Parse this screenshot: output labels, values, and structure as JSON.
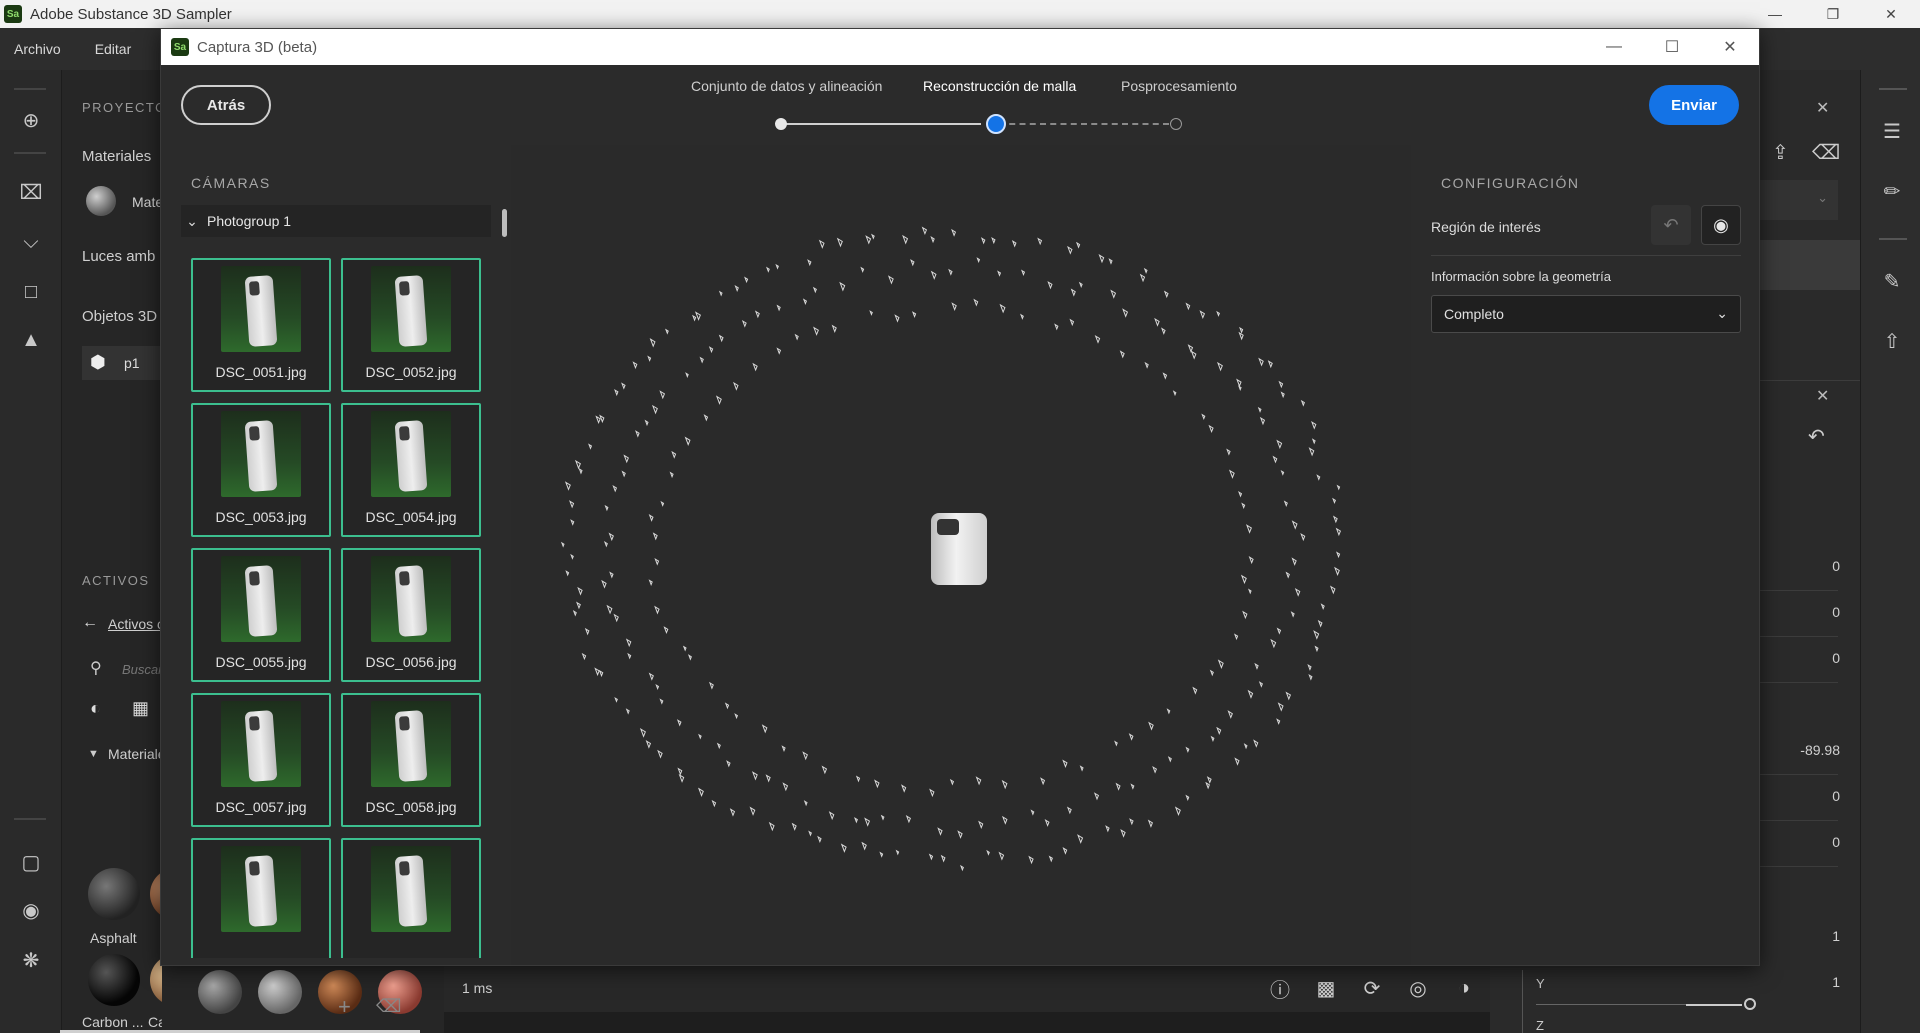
{
  "app": {
    "title": "Adobe Substance 3D Sampler",
    "logo": "Sa",
    "menu": [
      "Archivo",
      "Editar"
    ]
  },
  "left_panel": {
    "project_caption": "PROYECTO",
    "materials": "Materiales",
    "material_item": "Mate",
    "lights": "Luces amb",
    "objects": "Objetos 3D",
    "object_item": "p1",
    "assets_caption": "ACTIVOS",
    "assets_link": "Activos c",
    "search_placeholder": "Buscar",
    "materials_group": "Materiales",
    "asset_names": [
      "Asphalt",
      "Carbon ...",
      "Ca"
    ]
  },
  "right_area": {
    "values": [
      "0",
      "0",
      "0",
      "-89.98",
      "0",
      "0",
      "1",
      "1"
    ],
    "y_label": "Y",
    "z_label": "Z"
  },
  "bottom_status": {
    "time": "1 ms"
  },
  "dialog": {
    "title": "Captura 3D (beta)",
    "logo": "Sa",
    "back_label": "Atrás",
    "send_label": "Enviar",
    "steps": [
      {
        "label": "Conjunto de datos y alineación",
        "state": "done"
      },
      {
        "label": "Reconstrucción de malla",
        "state": "active"
      },
      {
        "label": "Posprocesamiento",
        "state": "todo"
      }
    ],
    "cameras": {
      "caption": "CÁMARAS",
      "group": "Photogroup 1",
      "images": [
        "DSC_0051.jpg",
        "DSC_0052.jpg",
        "DSC_0053.jpg",
        "DSC_0054.jpg",
        "DSC_0055.jpg",
        "DSC_0056.jpg",
        "DSC_0057.jpg",
        "DSC_0058.jpg",
        "",
        ""
      ]
    },
    "config": {
      "caption": "CONFIGURACIÓN",
      "roi_label": "Región de interés",
      "geometry_label": "Información sobre la geometría",
      "geometry_value": "Completo"
    }
  },
  "colors": {
    "accent": "#1473e6",
    "thumb_border": "#3cbf8f"
  }
}
